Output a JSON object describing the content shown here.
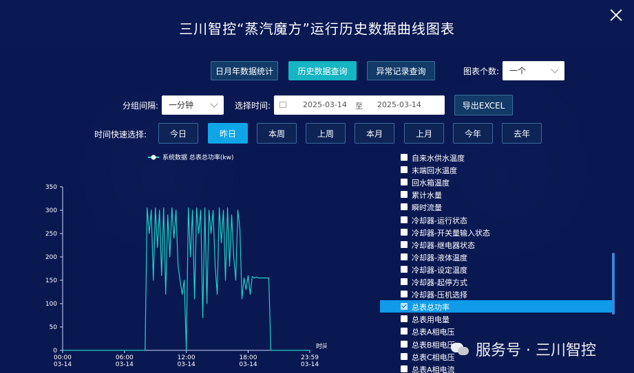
{
  "title": "三川智控“蒸汽魔方”运行历史数据曲线图表",
  "tabs": [
    {
      "label": "日月年数据统计"
    },
    {
      "label": "历史数据查询"
    },
    {
      "label": "异常记录查询"
    }
  ],
  "chart_count": {
    "label": "图表个数:",
    "value": "一个"
  },
  "interval": {
    "label": "分组间隔:",
    "value": "一分钟"
  },
  "date_range": {
    "label": "选择时间:",
    "start": "2025-03-14",
    "separator": "至",
    "end": "2025-03-14"
  },
  "export_label": "导出EXCEL",
  "quick_select": {
    "label": "时间快速选择:",
    "options": [
      "今日",
      "昨日",
      "本周",
      "上周",
      "本月",
      "上月",
      "今年",
      "去年"
    ],
    "selected": "昨日"
  },
  "metrics": [
    {
      "label": "自来水供水温度",
      "checked": false
    },
    {
      "label": "末端回水温度",
      "checked": false
    },
    {
      "label": "回水箱温度",
      "checked": false
    },
    {
      "label": "累计水量",
      "checked": false
    },
    {
      "label": "瞬时流量",
      "checked": false
    },
    {
      "label": "冷却器-运行状态",
      "checked": false
    },
    {
      "label": "冷却器-开关量输入状态",
      "checked": false
    },
    {
      "label": "冷却器-继电器状态",
      "checked": false
    },
    {
      "label": "冷却器-液体温度",
      "checked": false
    },
    {
      "label": "冷却器-设定温度",
      "checked": false
    },
    {
      "label": "冷却器-起停方式",
      "checked": false
    },
    {
      "label": "冷却器-压机选择",
      "checked": false
    },
    {
      "label": "总表总功率",
      "checked": true
    },
    {
      "label": "总表用电量",
      "checked": false
    },
    {
      "label": "总表A相电压",
      "checked": false
    },
    {
      "label": "总表B相电压",
      "checked": false
    },
    {
      "label": "总表C相电压",
      "checked": false
    },
    {
      "label": "总表A相电流",
      "checked": false
    }
  ],
  "watermark": "服务号 · 三川智控",
  "colors": {
    "series": "#20d4c8",
    "active_tab": "#16b5c4",
    "active_quick": "#0fa6e8"
  },
  "chart_data": {
    "type": "line",
    "legend": "系统数据 总表总功率(kw)",
    "xlabel": "时间",
    "ylim": [
      0,
      350
    ],
    "yticks": [
      0,
      50,
      100,
      150,
      200,
      250,
      300,
      350
    ],
    "xticks": [
      "00:00\n03-14",
      "06:00\n03-14",
      "12:00\n03-14",
      "18:00\n03-14",
      "23:59\n03-14"
    ],
    "xlim_hours": [
      0,
      23.98
    ],
    "series": [
      {
        "name": "总表总功率(kw)",
        "x": [
          0,
          8.0,
          8.1,
          8.2,
          8.4,
          8.6,
          8.8,
          9.0,
          9.2,
          9.4,
          9.6,
          9.8,
          10.0,
          10.2,
          10.4,
          10.6,
          10.8,
          11.0,
          11.2,
          11.4,
          11.6,
          11.8,
          12.0,
          12.2,
          12.4,
          12.6,
          12.8,
          13.0,
          13.2,
          13.4,
          13.6,
          13.8,
          14.0,
          14.2,
          14.4,
          14.6,
          14.8,
          15.0,
          15.2,
          15.4,
          15.6,
          15.8,
          16.0,
          16.2,
          16.4,
          16.6,
          16.8,
          17.0,
          17.2,
          17.4,
          17.6,
          17.8,
          18.0,
          18.2,
          18.4,
          18.6,
          18.8,
          19.0,
          19.2,
          19.4,
          19.6,
          19.8,
          20.0,
          20.1,
          20.2,
          23.98
        ],
        "values": [
          0,
          0,
          150,
          305,
          250,
          300,
          150,
          305,
          220,
          300,
          160,
          305,
          120,
          290,
          200,
          305,
          240,
          300,
          180,
          150,
          120,
          150,
          0,
          305,
          200,
          300,
          110,
          305,
          250,
          300,
          70,
          305,
          100,
          300,
          250,
          300,
          180,
          120,
          305,
          230,
          300,
          150,
          305,
          180,
          290,
          200,
          150,
          300,
          260,
          110,
          155,
          130,
          160,
          120,
          158,
          155,
          157,
          155,
          155,
          155,
          155,
          155,
          155,
          80,
          0,
          0
        ]
      }
    ]
  }
}
